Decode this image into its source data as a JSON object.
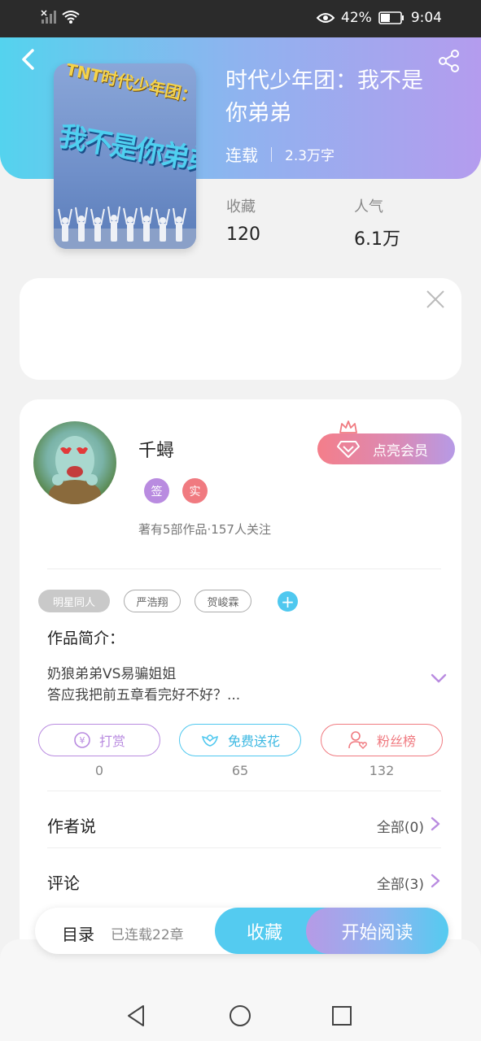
{
  "status_bar": {
    "battery": "42%",
    "time": "9:04"
  },
  "book": {
    "title": "时代少年团：我不是你弟弟",
    "status": "连载",
    "word_count": "2.3万字",
    "cover_title_line1": "TNT时代少年团：",
    "cover_title_line2": "我不是你弟弟",
    "stats": {
      "collect_label": "收藏",
      "collect_value": "120",
      "popularity_label": "人气",
      "popularity_value": "6.1万"
    }
  },
  "author": {
    "name": "千蟳",
    "badges": [
      {
        "label": "签",
        "color": "#b98be0"
      },
      {
        "label": "实",
        "color": "#f07a80"
      }
    ],
    "stats": "著有5部作品·157人关注",
    "vip_label": "点亮会员"
  },
  "tags": [
    "明星同人",
    "严浩翔",
    "贺峻霖"
  ],
  "intro": {
    "title": "作品简介：",
    "line1": "奶狼弟弟VS易骗姐姐",
    "line2": "答应我把前五章看完好不好？..."
  },
  "actions": [
    {
      "label": "打赏",
      "count": "0",
      "color": "#b98be0"
    },
    {
      "label": "免费送花",
      "count": "65",
      "color": "#4fc8ef"
    },
    {
      "label": "粉丝榜",
      "count": "132",
      "color": "#f07a80"
    }
  ],
  "sections": {
    "author_says": {
      "title": "作者说",
      "more": "全部(0)"
    },
    "comments": {
      "title": "评论",
      "more": "全部(3)"
    }
  },
  "bottom_bar": {
    "toc_label": "目录",
    "toc_count": "已连载22章",
    "collect_label": "收藏",
    "read_label": "开始阅读"
  },
  "colors": {
    "accent_cyan": "#54cbf0",
    "accent_purple": "#b69ae6",
    "accent_pink": "#f07a80"
  }
}
